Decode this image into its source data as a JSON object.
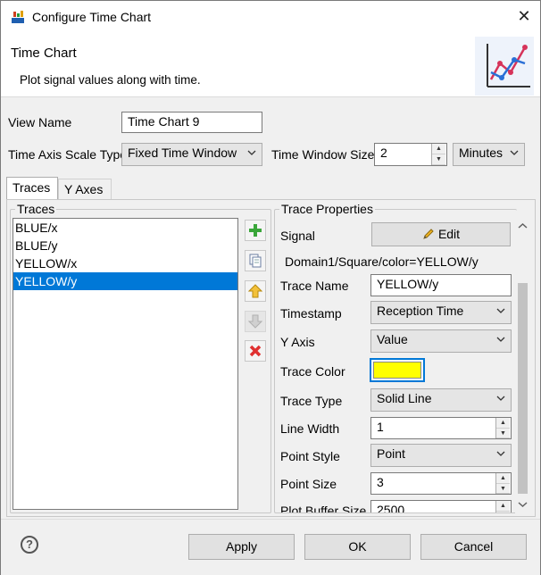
{
  "window": {
    "title": "Configure Time Chart"
  },
  "header": {
    "title": "Time Chart",
    "description": "Plot signal values along with time."
  },
  "form": {
    "view_name_label": "View Name",
    "view_name_value": "Time Chart 9",
    "scale_type_label": "Time Axis Scale Type",
    "scale_type_value": "Fixed Time Window",
    "window_size_label": "Time Window Size",
    "window_size_value": "2",
    "window_unit_value": "Minutes"
  },
  "tabs": [
    {
      "label": "Traces"
    },
    {
      "label": "Y Axes"
    }
  ],
  "traces": {
    "group_title": "Traces",
    "items": [
      "BLUE/x",
      "BLUE/y",
      "YELLOW/x",
      "YELLOW/y"
    ],
    "selected_index": 3
  },
  "trace_properties": {
    "group_title": "Trace Properties",
    "signal_label": "Signal",
    "edit_button_label": "Edit",
    "signal_path": "Domain1/Square/color=YELLOW/y",
    "trace_name_label": "Trace Name",
    "trace_name_value": "YELLOW/y",
    "timestamp_label": "Timestamp",
    "timestamp_value": "Reception Time",
    "y_axis_label": "Y Axis",
    "y_axis_value": "Value",
    "trace_color_label": "Trace Color",
    "trace_color": "#ffff00",
    "trace_type_label": "Trace Type",
    "trace_type_value": "Solid Line",
    "line_width_label": "Line Width",
    "line_width_value": "1",
    "point_style_label": "Point Style",
    "point_style_value": "Point",
    "point_size_label": "Point Size",
    "point_size_value": "3",
    "plot_buffer_label": "Plot Buffer Size",
    "plot_buffer_value": "2500"
  },
  "footer": {
    "apply_label": "Apply",
    "ok_label": "OK",
    "cancel_label": "Cancel"
  },
  "colors": {
    "selection": "#0078d7",
    "accent": "#0078d7"
  }
}
